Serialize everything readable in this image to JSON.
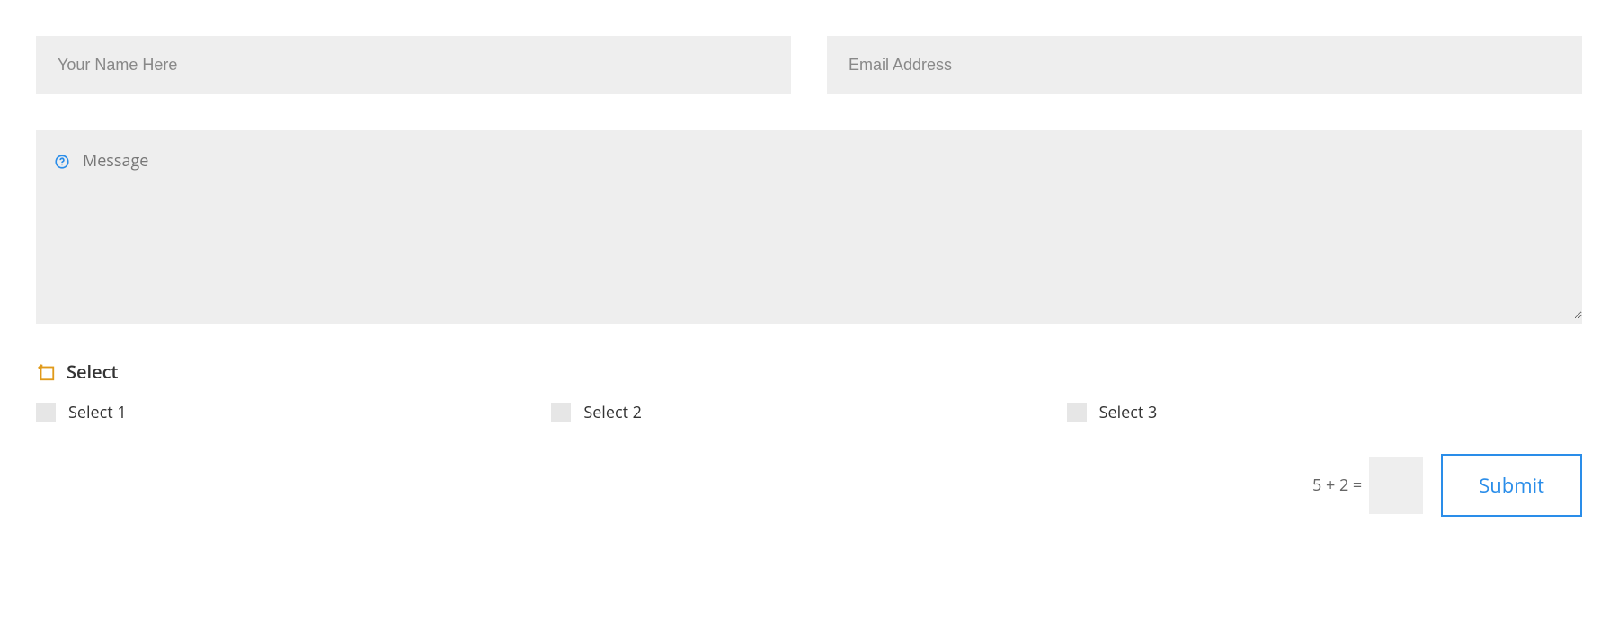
{
  "fields": {
    "name": {
      "placeholder": "Your Name Here",
      "value": ""
    },
    "email": {
      "placeholder": "Email Address",
      "value": ""
    },
    "message": {
      "placeholder": "Message",
      "value": ""
    }
  },
  "select": {
    "title": "Select",
    "options": [
      {
        "label": "Select 1"
      },
      {
        "label": "Select 2"
      },
      {
        "label": "Select 3"
      }
    ]
  },
  "captcha": {
    "question": "5 + 2 =",
    "value": ""
  },
  "submit": {
    "label": "Submit"
  }
}
